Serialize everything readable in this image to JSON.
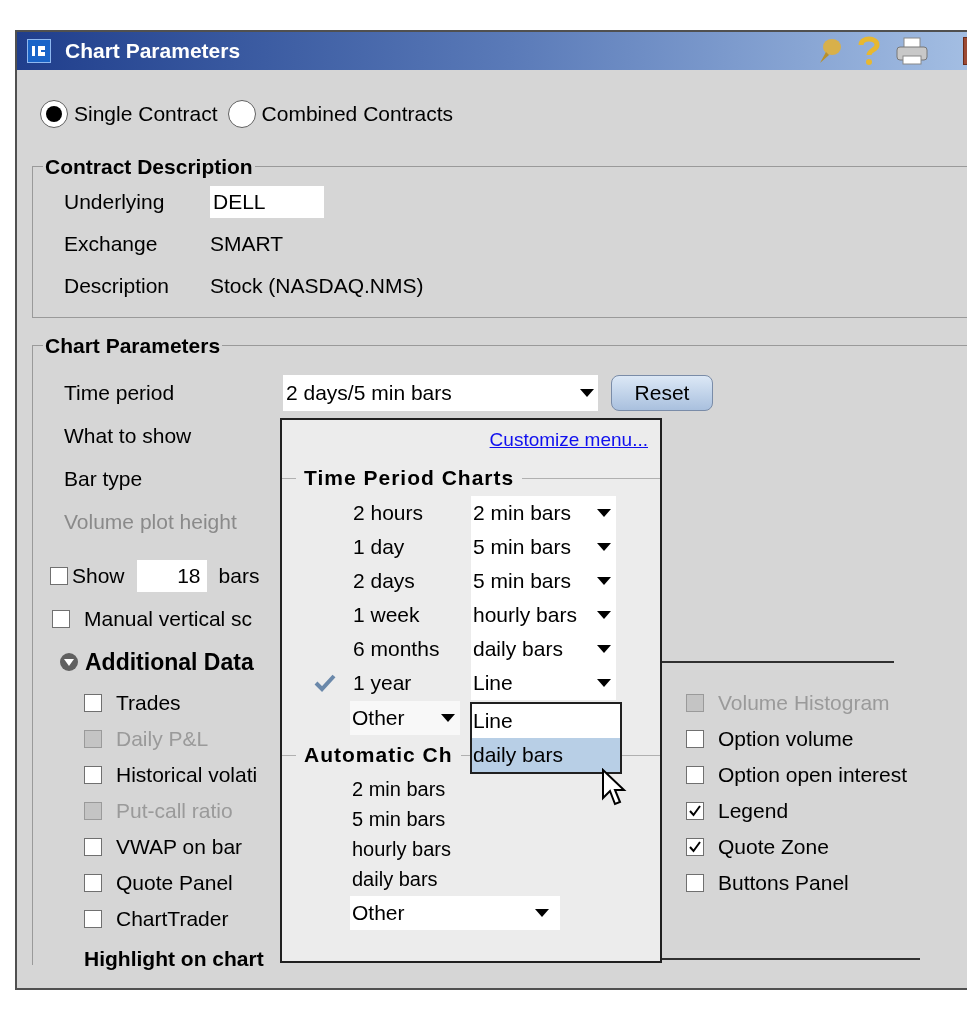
{
  "window": {
    "title": "Chart Parameters"
  },
  "contract_type": [
    {
      "label": "Single Contract",
      "selected": true
    },
    {
      "label": "Combined Contracts",
      "selected": false
    }
  ],
  "contract_description": {
    "title": "Contract Description",
    "fields": [
      {
        "label": "Underlying",
        "value": "DELL",
        "kind": "input"
      },
      {
        "label": "Exchange",
        "value": "SMART",
        "kind": "text"
      },
      {
        "label": "Description",
        "value": "Stock (NASDAQ.NMS)",
        "kind": "text"
      }
    ]
  },
  "chart_parameters": {
    "title": "Chart Parameters",
    "time_period": {
      "label": "Time period",
      "value": "2 days/5 min bars"
    },
    "reset_button": "Reset",
    "what_to_show": {
      "label": "What to show"
    },
    "bar_type": {
      "label": "Bar type"
    },
    "volume_plot_height": {
      "label": "Volume plot height",
      "disabled": true
    },
    "show_bars": {
      "label": "Show",
      "value": "18",
      "suffix": "bars",
      "checked": false
    },
    "manual_vertical_scale": {
      "label": "Manual vertical sc",
      "checked": false
    }
  },
  "additional_data": {
    "title": "Additional Data",
    "expanded": true,
    "left": [
      {
        "label": "Trades",
        "checked": false,
        "disabled": false
      },
      {
        "label": "Daily P&L",
        "checked": false,
        "disabled": true
      },
      {
        "label": "Historical volati",
        "checked": false,
        "disabled": false
      },
      {
        "label": "Put-call ratio",
        "checked": false,
        "disabled": true
      },
      {
        "label": "VWAP on bar",
        "checked": false,
        "disabled": false
      },
      {
        "label": "Quote Panel",
        "checked": false,
        "disabled": false
      },
      {
        "label": "ChartTrader",
        "checked": false,
        "disabled": false
      }
    ],
    "right": [
      {
        "label": "Volume Histogram",
        "checked": false,
        "disabled": true
      },
      {
        "label": "Option volume",
        "checked": false,
        "disabled": false
      },
      {
        "label": "Option open interest",
        "checked": false,
        "disabled": false
      },
      {
        "label": "Legend",
        "checked": true,
        "disabled": false
      },
      {
        "label": "Quote Zone",
        "checked": true,
        "disabled": false
      },
      {
        "label": "Buttons Panel",
        "checked": false,
        "disabled": false
      }
    ]
  },
  "highlight_on_chart": {
    "title": "Highlight on chart"
  },
  "time_period_menu": {
    "link": "Customize menu...",
    "time_period_heading": "Time Period Charts",
    "periods": [
      {
        "period": "2 hours",
        "bars": "2 min bars",
        "selected": false
      },
      {
        "period": "1 day",
        "bars": "5 min bars",
        "selected": false
      },
      {
        "period": "2 days",
        "bars": "5 min bars",
        "selected": false
      },
      {
        "period": "1 week",
        "bars": "hourly bars",
        "selected": false
      },
      {
        "period": "6 months",
        "bars": "daily bars",
        "selected": false
      },
      {
        "period": "1 year",
        "bars": "Line",
        "selected": true
      }
    ],
    "other": "Other",
    "automatic_heading": "Automatic Ch",
    "automatic_items": [
      "2 min bars",
      "5 min bars",
      "hourly bars",
      "daily bars"
    ],
    "automatic_other": "Other"
  },
  "bar_list": [
    {
      "label": "Line",
      "selected": false
    },
    {
      "label": "daily bars",
      "selected": true
    }
  ]
}
